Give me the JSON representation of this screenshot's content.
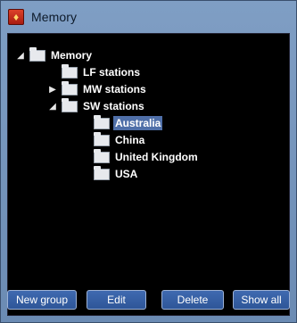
{
  "window": {
    "title": "Memory",
    "icon": "app-radio-icon"
  },
  "tree": {
    "root": {
      "label": "Memory",
      "expanded": true,
      "children": [
        {
          "label": "LF stations",
          "expander": "none"
        },
        {
          "label": "MW stations",
          "expander": "collapsed"
        },
        {
          "label": "SW stations",
          "expander": "expanded",
          "children": [
            {
              "label": "Australia",
              "selected": true
            },
            {
              "label": "China"
            },
            {
              "label": "United Kingdom"
            },
            {
              "label": "USA"
            }
          ]
        }
      ]
    }
  },
  "buttons": {
    "new_group": "New group",
    "edit": "Edit",
    "delete": "Delete",
    "show_all": "Show all"
  },
  "colors": {
    "selection": "#4f6fa8",
    "button_bg": "#3f6ab0",
    "frame": "#6f8fb3"
  }
}
